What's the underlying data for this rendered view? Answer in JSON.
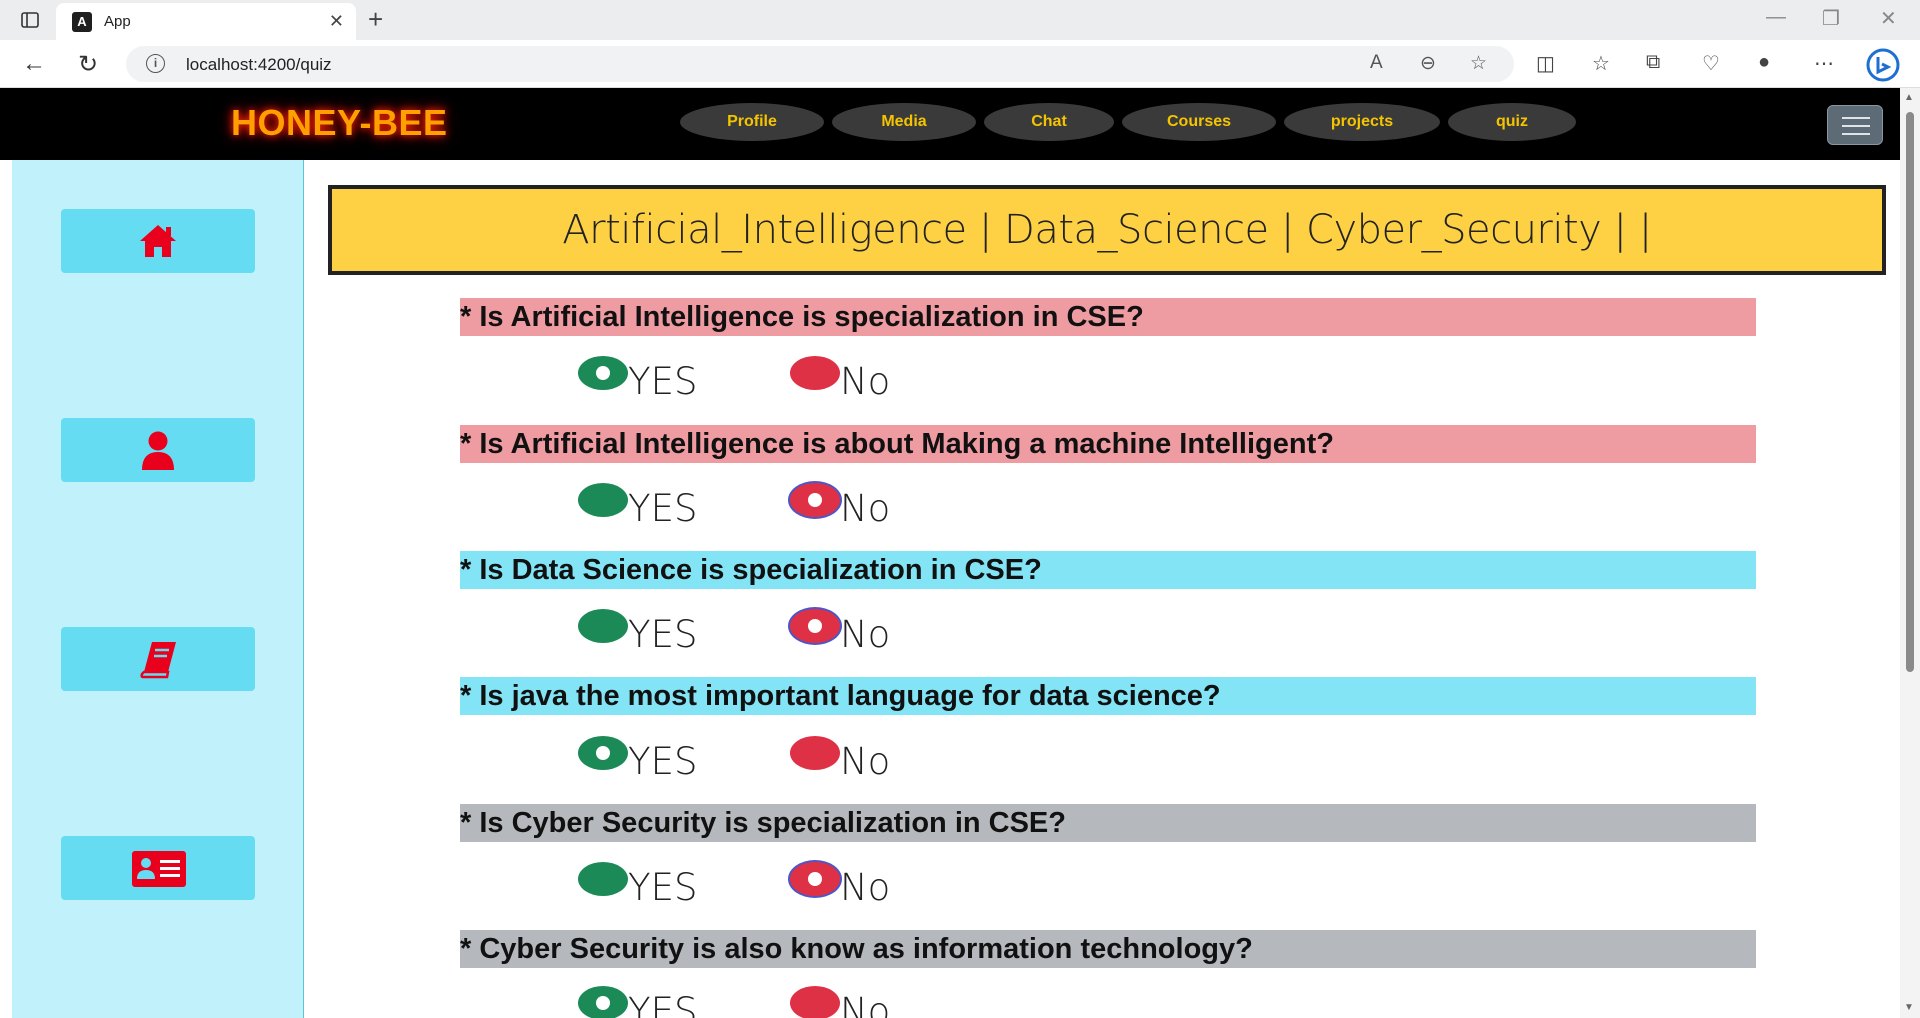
{
  "browser": {
    "tab_title": "App",
    "tab_favicon": "A",
    "url": "localhost:4200/quiz"
  },
  "navbar": {
    "brand": "HONEY-BEE",
    "links": [
      "Profile",
      "Media",
      "Chat",
      "Courses",
      "projects",
      "quiz"
    ]
  },
  "sidebar": {
    "items": [
      "home-icon",
      "user-icon",
      "book-icon",
      "id-card-icon"
    ]
  },
  "banner": {
    "text": "Artificial_Intelligence | Data_Science | Cyber_Security | |"
  },
  "quiz": {
    "yes_label": "YES",
    "no_label": "No",
    "questions": [
      {
        "text": "* Is Artificial Intelligence is specialization in CSE?",
        "answer": "YES"
      },
      {
        "text": "* Is Artificial Intelligence is about Making a machine Intelligent?",
        "answer": "No"
      },
      {
        "text": "* Is Data Science is specialization in CSE?",
        "answer": "No"
      },
      {
        "text": "* Is java the most important language for data science?",
        "answer": "YES"
      },
      {
        "text": "* Is Cyber Security is specialization in CSE?",
        "answer": "No"
      },
      {
        "text": "* Cyber Security is also know as information technology?",
        "answer": "YES"
      }
    ]
  },
  "colors": {
    "brand": "#ff9f00",
    "nav_link": "#f5c400",
    "banner_bg": "#fdd143",
    "sidebar_bg": "#c1f1fb",
    "sidebar_button": "#66dcf2",
    "icon_red": "#e8001c",
    "q_ai": "#ef9ba2",
    "q_ds": "#83e4f6",
    "q_cs": "#b5b9bd",
    "radio_yes": "#1b8a57",
    "radio_no": "#df3145"
  }
}
